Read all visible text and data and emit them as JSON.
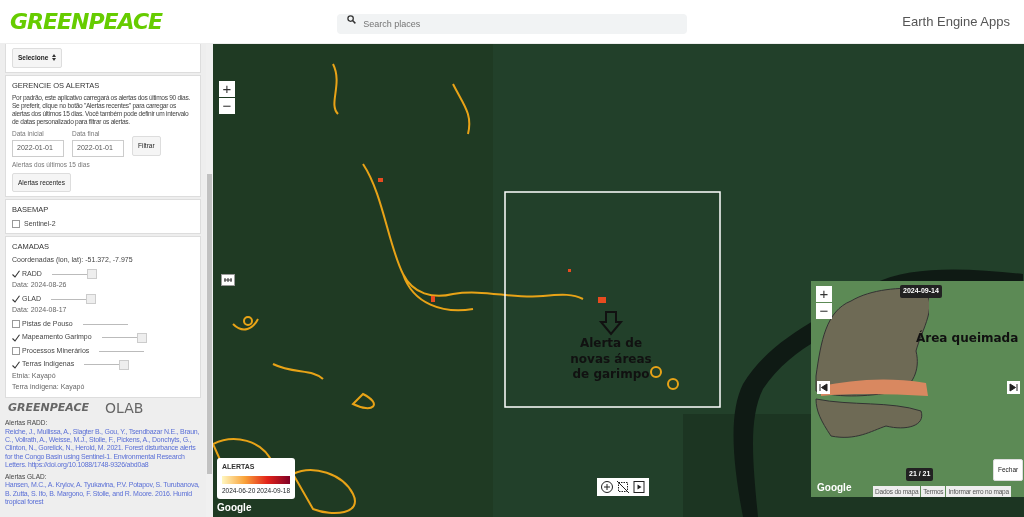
{
  "header": {
    "logo": "GREENPEACE",
    "search": {
      "placeholder": "Search places"
    },
    "app_title": "Earth Engine Apps"
  },
  "sidebar": {
    "select": {
      "value": "Selecione"
    },
    "alerts": {
      "title": "GERENCIE OS ALERTAS",
      "description": "Por padrão, este aplicativo carregará os alertas dos últimos 90 dias. Se preferir, clique no botão \"Alertas recentes\" para carregar os alertas dos últimos 15 dias. Você também pode definir um intervalo de datas personalizado para filtrar os alertas.",
      "start_label": "Data inicial",
      "start_value": "2022-01-01",
      "end_label": "Data final",
      "end_value": "2022-01-01",
      "filter_button": "Filtrar",
      "recent_label": "Alertas dos últimos 15 dias",
      "recent_button": "Alertas recentes"
    },
    "basemap": {
      "title": "BASEMAP",
      "options": [
        {
          "label": "Sentinel-2",
          "checked": false
        }
      ]
    },
    "layers": {
      "title": "CAMADAS",
      "coordinates": "Coordenadas (lon, lat): -51.372, -7.975",
      "items": [
        {
          "label": "RADD",
          "checked": true,
          "level": 1,
          "info": [
            "Data: 2024-08-26"
          ]
        },
        {
          "label": "GLAD",
          "checked": true,
          "level": 1,
          "info": [
            "Data: 2024-08-17"
          ]
        },
        {
          "label": "Pistas de Pouso",
          "checked": false
        },
        {
          "label": "Mapeamento Garimpo",
          "checked": true,
          "level": 1
        },
        {
          "label": "Processos Minerários",
          "checked": false
        },
        {
          "label": "Terras Indígenas",
          "checked": true,
          "level": 1,
          "info": [
            "Etnia: Kayapó",
            "Terra indígena: Kayapó"
          ]
        }
      ]
    },
    "credits": {
      "logos": [
        "GREENPEACE",
        "OLAB"
      ],
      "refs": [
        {
          "title": "Alertas RADD:",
          "text": "Reiche, J., Mullissa, A., Slagter B., Gou, Y., Tsendbazar N.E., Braun, C., Vollrath, A., Weisse, M.J., Stolle, F., Pickens, A., Donchyts, G., Clinton, N., Gorelick, N., Herold, M. 2021. Forest disturbance alerts for the Congo Basin using Sentinel-1. Environmental Research Letters. https://doi.org/10.1088/1748-9326/abd0a8"
        },
        {
          "title": "Alertas GLAD:",
          "text": "Hansen, M.C., A. Krylov, A. Tyukavina, P.V. Potapov, S. Turubanova, B. Zutta, S. Ifo, B. Margono, F. Stolle, and R. Moore. 2016. Humid tropical forest"
        }
      ]
    }
  },
  "map": {
    "zoom_in": "+",
    "zoom_out": "−",
    "annotation": "Alerta de novas áreas de garimpo",
    "legend": {
      "title": "ALERTAS",
      "start": "2024-06-20",
      "end": "2024-09-18"
    },
    "google": "Google",
    "inset": {
      "date": "2024-09-14",
      "label": "Área queimada",
      "counter": "21 / 21",
      "close_button": "Fechar",
      "zoom_in": "+",
      "zoom_out": "−",
      "google": "Google",
      "attribution": [
        "Dados do mapa",
        "Termos",
        "Informar erro no mapa"
      ]
    }
  }
}
